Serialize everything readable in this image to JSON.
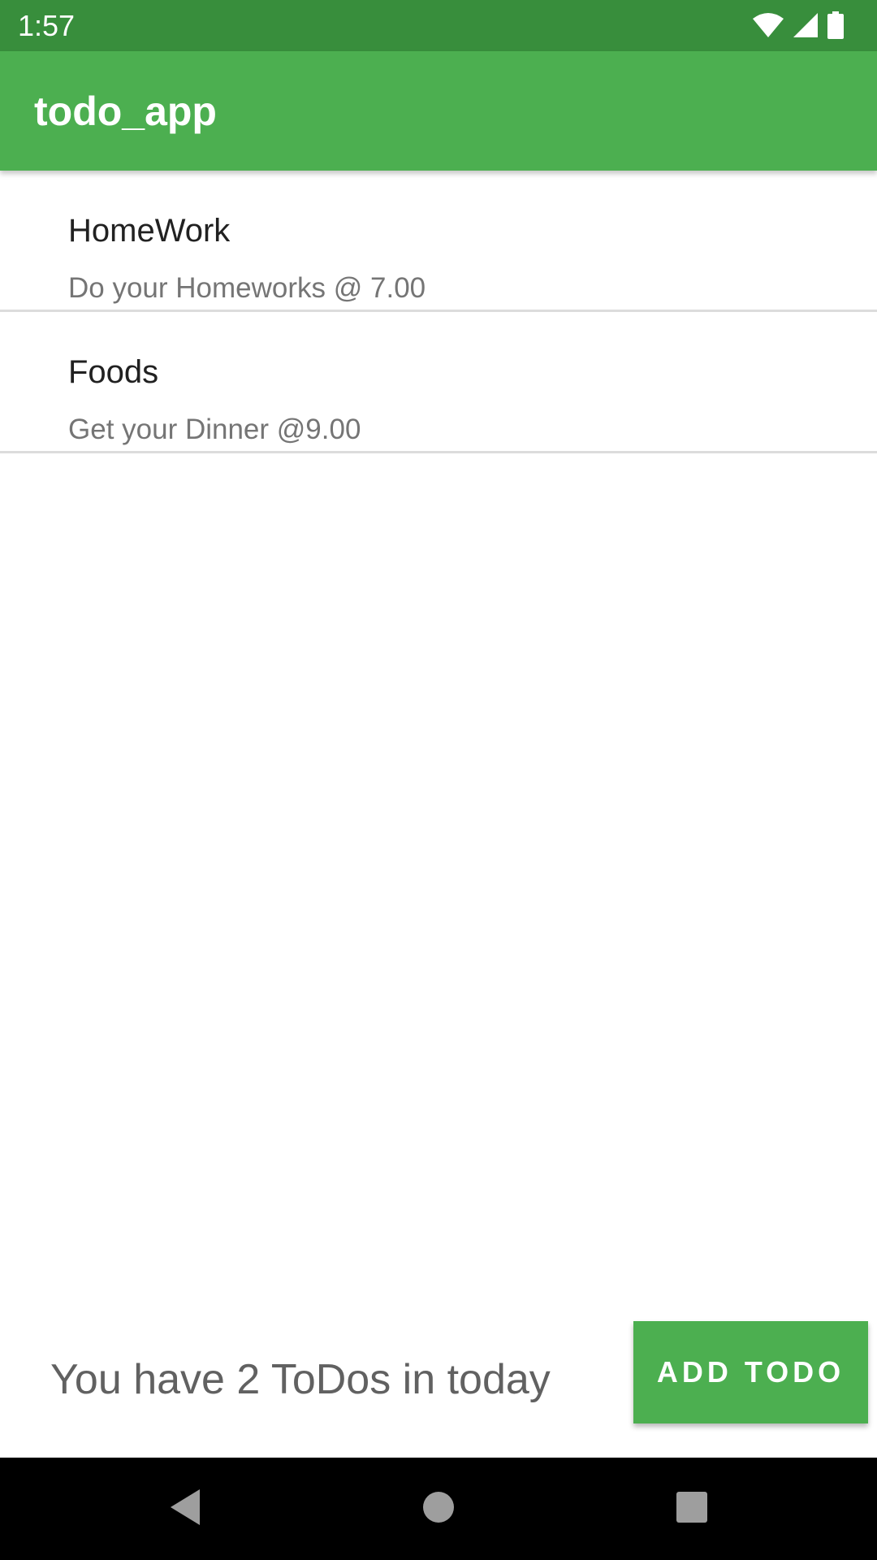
{
  "status_bar": {
    "time": "1:57",
    "icons": [
      "wifi-icon",
      "signal-icon",
      "battery-icon"
    ]
  },
  "app_bar": {
    "title": "todo_app",
    "color": "#4caf50"
  },
  "todos": [
    {
      "title": "HomeWork",
      "description": "Do your Homeworks @ 7.00"
    },
    {
      "title": "Foods",
      "description": "Get your Dinner @9.00"
    }
  ],
  "footer": {
    "count_text": "You have 2 ToDos in today",
    "add_button_label": "ADD TODO"
  },
  "nav_bar": {
    "buttons": [
      "back-icon",
      "home-icon",
      "recents-icon"
    ]
  },
  "colors": {
    "status_bar": "#388e3c",
    "primary": "#4caf50"
  }
}
